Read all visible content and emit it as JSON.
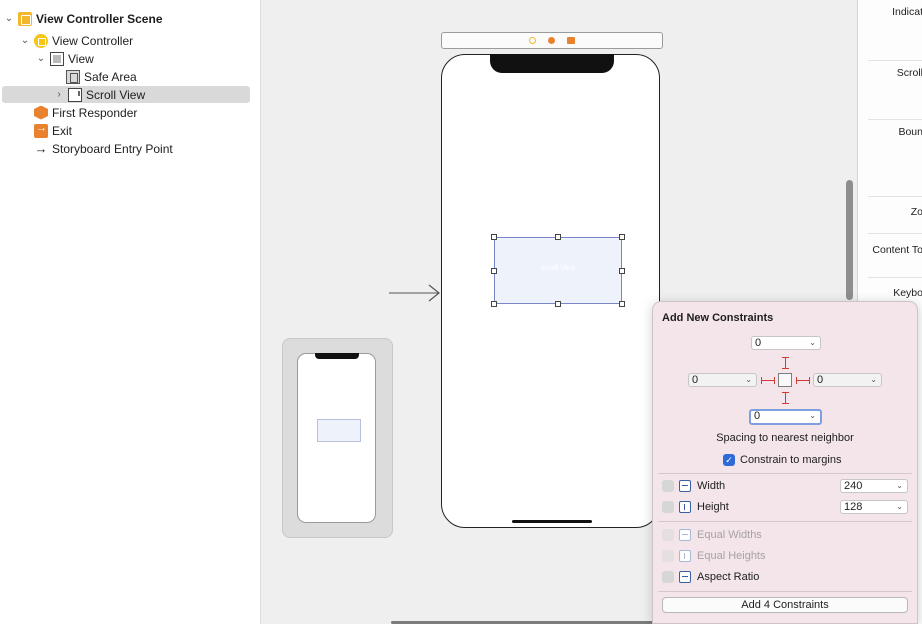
{
  "outline": {
    "items": [
      {
        "label": "View Controller Scene",
        "icon": "scene-icon",
        "disclosure": "expanded"
      },
      {
        "label": "View Controller",
        "icon": "view-controller-icon",
        "disclosure": "expanded"
      },
      {
        "label": "View",
        "icon": "view-icon",
        "disclosure": "expanded"
      },
      {
        "label": "Safe Area",
        "icon": "safe-area-icon",
        "disclosure": "none"
      },
      {
        "label": "Scroll View",
        "icon": "scroll-view-icon",
        "disclosure": "collapsed",
        "selected": true
      },
      {
        "label": "First Responder",
        "icon": "first-responder-icon",
        "disclosure": "none"
      },
      {
        "label": "Exit",
        "icon": "exit-icon",
        "disclosure": "none"
      },
      {
        "label": "Storyboard Entry Point",
        "icon": "entry-point-arrow-icon",
        "disclosure": "none"
      }
    ]
  },
  "canvas": {
    "scroll_view_caption": "Scroll View"
  },
  "inspector": {
    "labels": [
      "Indicat",
      "Scroll",
      "Boun",
      "Zo",
      "Content To",
      "Keybo"
    ]
  },
  "constraints_popover": {
    "title": "Add New Constraints",
    "top": "0",
    "left": "0",
    "right": "0",
    "bottom": "0",
    "spacing_label": "Spacing to nearest neighbor",
    "constrain_to_margins": {
      "label": "Constrain to margins",
      "checked": true
    },
    "rows": [
      {
        "label": "Width",
        "value": "240",
        "checked": false,
        "enabled": true,
        "icon": "width-constraint-icon"
      },
      {
        "label": "Height",
        "value": "128",
        "checked": false,
        "enabled": true,
        "icon": "height-constraint-icon"
      },
      {
        "label": "Equal Widths",
        "checked": false,
        "enabled": false,
        "icon": "equal-widths-icon"
      },
      {
        "label": "Equal Heights",
        "checked": false,
        "enabled": false,
        "icon": "equal-heights-icon"
      },
      {
        "label": "Aspect Ratio",
        "checked": false,
        "enabled": true,
        "icon": "aspect-ratio-icon"
      }
    ],
    "add_button": "Add 4 Constraints"
  },
  "colors": {
    "accent": "#2e6bd9",
    "strut": "#d23b34",
    "selection_outline": "#7a86c8",
    "popover_bg": "#f3e5ea"
  }
}
